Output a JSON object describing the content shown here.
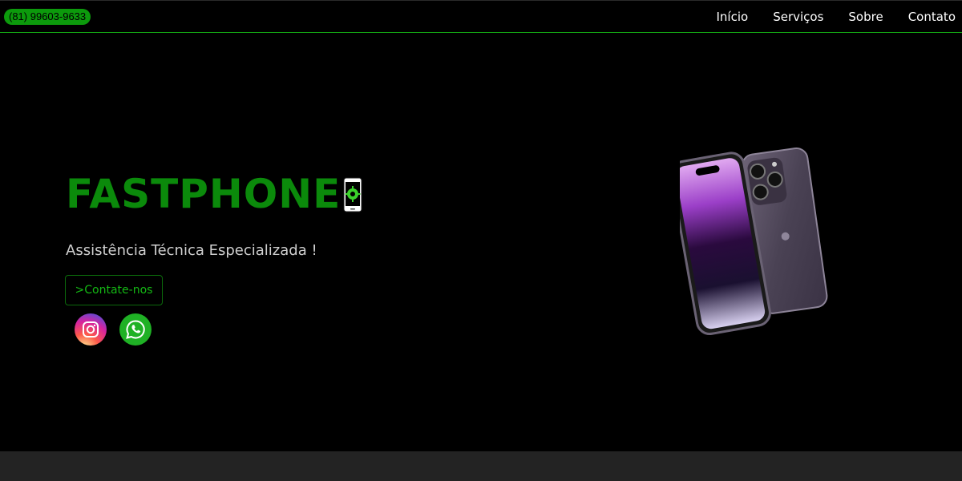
{
  "header": {
    "phone": "(81) 99603-9633",
    "nav": {
      "inicio": "Início",
      "servicos": "Serviços",
      "sobre": "Sobre",
      "contato": "Contato"
    }
  },
  "hero": {
    "title": "FASTPHONE",
    "title_icon": "phone-repair-gear-icon",
    "subtitle": "Assistência Técnica Especializada !",
    "cta_label": ">Contate-nos",
    "social": {
      "instagram_icon": "instagram-icon",
      "whatsapp_icon": "whatsapp-icon"
    },
    "product_image": "iphone-image"
  },
  "colors": {
    "background": "#000000",
    "brand_green": "#0b8a0b",
    "phone_pill": "#0c9a0c",
    "header_border": "#14a814",
    "footer_band": "#232323",
    "instagram": "#d6249f",
    "whatsapp": "#1fb125"
  }
}
